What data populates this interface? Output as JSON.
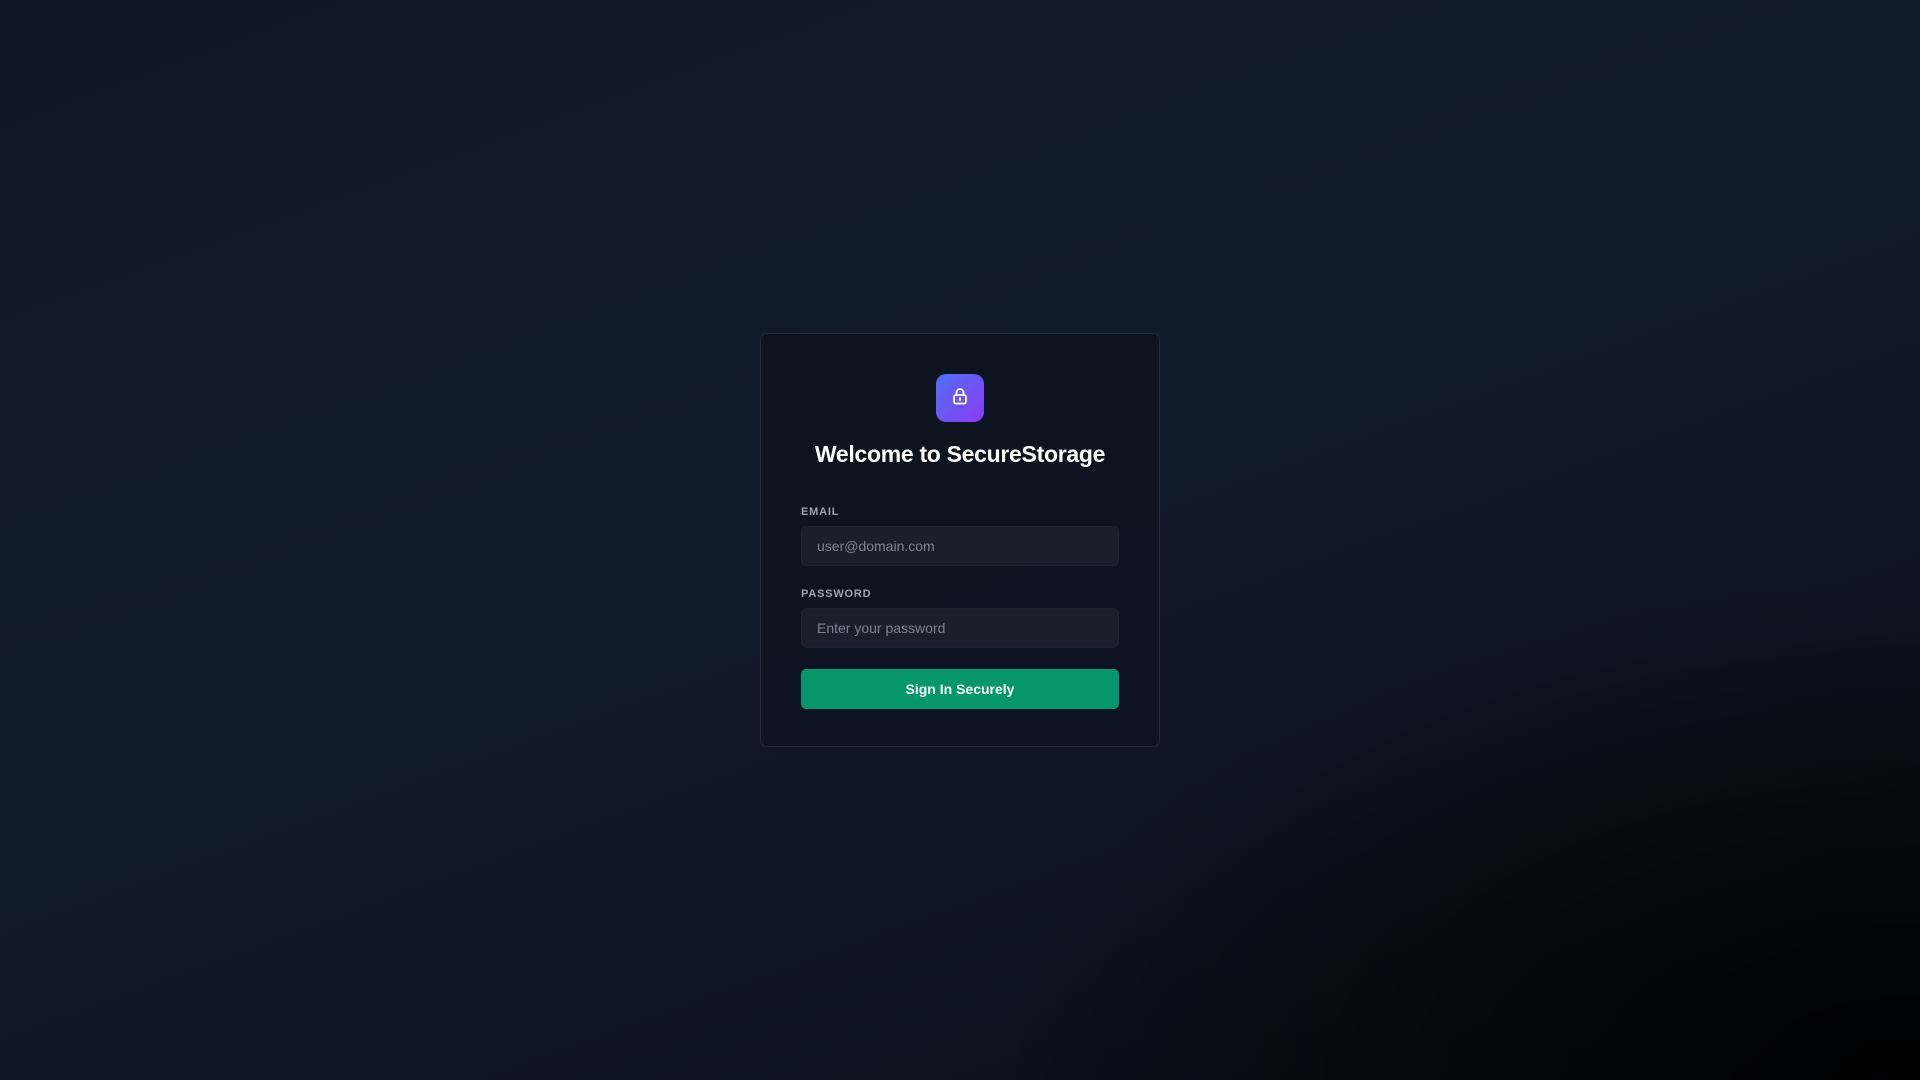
{
  "brand": {
    "icon": "lock-icon",
    "gradient_start": "#4f6ef7",
    "gradient_end": "#8b3cf0"
  },
  "title": "Welcome to SecureStorage",
  "form": {
    "email": {
      "label": "EMAIL",
      "placeholder": "user@domain.com",
      "value": ""
    },
    "password": {
      "label": "PASSWORD",
      "placeholder": "Enter your password",
      "value": ""
    },
    "submit_label": "Sign In Securely",
    "submit_color": "#059669"
  }
}
